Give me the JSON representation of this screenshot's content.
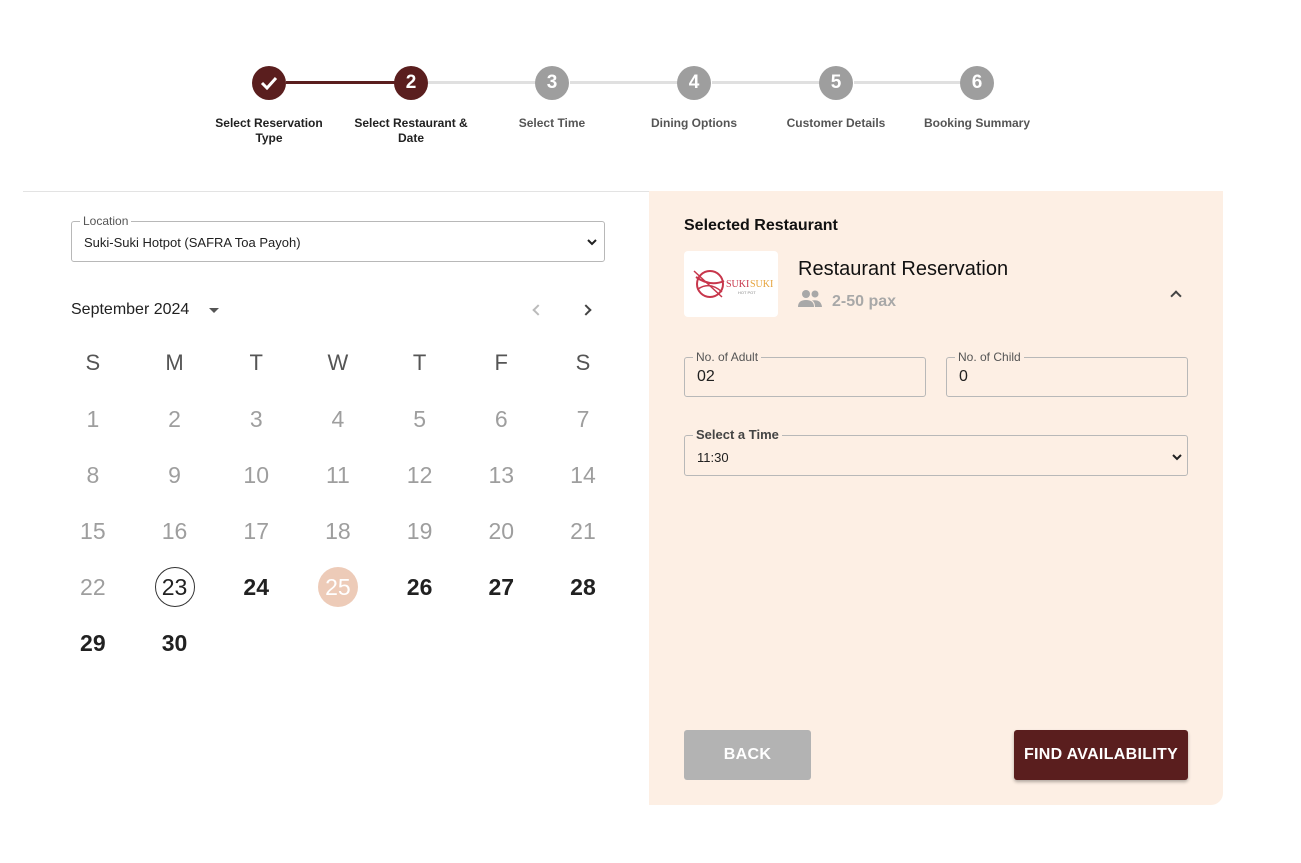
{
  "stepper": {
    "steps": [
      {
        "number": "",
        "label": "Select Reservation Type",
        "state": "complete"
      },
      {
        "number": "2",
        "label": "Select Restaurant & Date",
        "state": "active"
      },
      {
        "number": "3",
        "label": "Select Time",
        "state": "pending"
      },
      {
        "number": "4",
        "label": "Dining Options",
        "state": "pending"
      },
      {
        "number": "5",
        "label": "Customer Details",
        "state": "pending"
      },
      {
        "number": "6",
        "label": "Booking Summary",
        "state": "pending"
      }
    ]
  },
  "location": {
    "legend": "Location",
    "value": "Suki-Suki Hotpot (SAFRA Toa Payoh)"
  },
  "calendar": {
    "month_label": "September 2024",
    "weekdays": [
      "S",
      "M",
      "T",
      "W",
      "T",
      "F",
      "S"
    ],
    "weeks": [
      [
        {
          "d": "1",
          "s": "disabled"
        },
        {
          "d": "2",
          "s": "disabled"
        },
        {
          "d": "3",
          "s": "disabled"
        },
        {
          "d": "4",
          "s": "disabled"
        },
        {
          "d": "5",
          "s": "disabled"
        },
        {
          "d": "6",
          "s": "disabled"
        },
        {
          "d": "7",
          "s": "disabled"
        }
      ],
      [
        {
          "d": "8",
          "s": "disabled"
        },
        {
          "d": "9",
          "s": "disabled"
        },
        {
          "d": "10",
          "s": "disabled"
        },
        {
          "d": "11",
          "s": "disabled"
        },
        {
          "d": "12",
          "s": "disabled"
        },
        {
          "d": "13",
          "s": "disabled"
        },
        {
          "d": "14",
          "s": "disabled"
        }
      ],
      [
        {
          "d": "15",
          "s": "disabled"
        },
        {
          "d": "16",
          "s": "disabled"
        },
        {
          "d": "17",
          "s": "disabled"
        },
        {
          "d": "18",
          "s": "disabled"
        },
        {
          "d": "19",
          "s": "disabled"
        },
        {
          "d": "20",
          "s": "disabled"
        },
        {
          "d": "21",
          "s": "disabled"
        }
      ],
      [
        {
          "d": "22",
          "s": "disabled"
        },
        {
          "d": "23",
          "s": "today"
        },
        {
          "d": "24",
          "s": "available"
        },
        {
          "d": "25",
          "s": "selected"
        },
        {
          "d": "26",
          "s": "available"
        },
        {
          "d": "27",
          "s": "available"
        },
        {
          "d": "28",
          "s": "available"
        }
      ],
      [
        {
          "d": "29",
          "s": "available"
        },
        {
          "d": "30",
          "s": "available"
        }
      ]
    ]
  },
  "restaurant": {
    "heading": "Selected Restaurant",
    "title": "Restaurant Reservation",
    "pax": "2-50 pax",
    "logo_text": "SUKI SUKI",
    "logo_subtext": "HOT POT"
  },
  "guests": {
    "adult_legend": "No. of Adult",
    "adult_value": "02",
    "child_legend": "No. of Child",
    "child_value": "0"
  },
  "time": {
    "legend": "Select a Time",
    "value": "11:30"
  },
  "buttons": {
    "back": "BACK",
    "find": "FIND AVAILABILITY"
  },
  "colors": {
    "brand": "#5a1e1e",
    "panel": "#fdefe4",
    "selected_day": "#edcbb8"
  }
}
